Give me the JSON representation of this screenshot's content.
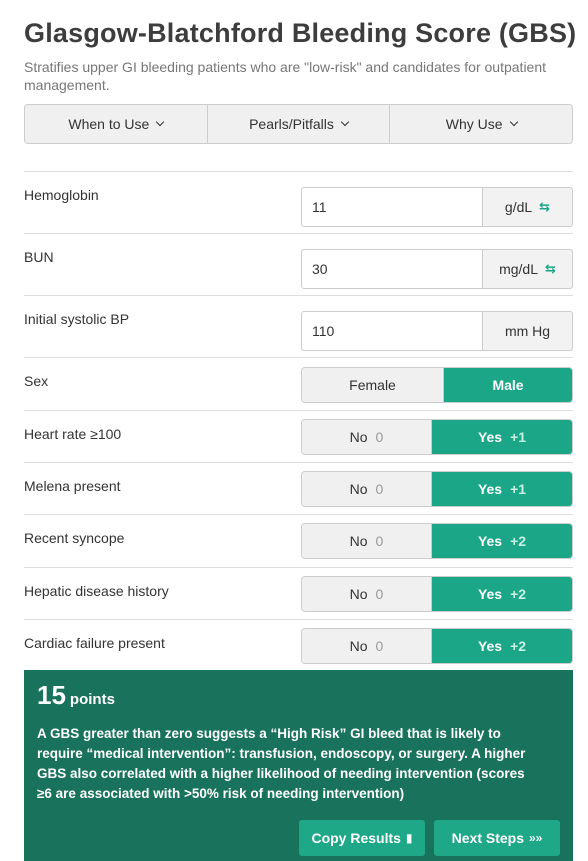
{
  "title": "Glasgow-Blatchford Bleeding Score (GBS)",
  "subtitle": "Stratifies upper GI bleeding patients who are \"low-risk\" and candidates for outpatient management.",
  "tabs": [
    {
      "label": "When to Use"
    },
    {
      "label": "Pearls/Pitfalls"
    },
    {
      "label": "Why Use"
    }
  ],
  "inputs": {
    "hemoglobin": {
      "label": "Hemoglobin",
      "value": "11",
      "unit": "g/dL"
    },
    "bun": {
      "label": "BUN",
      "value": "30",
      "unit": "mg/dL"
    },
    "sbp": {
      "label": "Initial systolic BP",
      "value": "110",
      "unit": "mm Hg"
    }
  },
  "sex": {
    "label": "Sex",
    "options": [
      "Female",
      "Male"
    ],
    "selected": "Male"
  },
  "toggles": {
    "heart_rate": {
      "label": "Heart rate ≥100",
      "no_label": "No",
      "no_pts": "0",
      "yes_label": "Yes",
      "yes_pts": "+1"
    },
    "melena": {
      "label": "Melena present",
      "no_label": "No",
      "no_pts": "0",
      "yes_label": "Yes",
      "yes_pts": "+1"
    },
    "syncope": {
      "label": "Recent syncope",
      "no_label": "No",
      "no_pts": "0",
      "yes_label": "Yes",
      "yes_pts": "+2"
    },
    "hepatic": {
      "label": "Hepatic disease history",
      "no_label": "No",
      "no_pts": "0",
      "yes_label": "Yes",
      "yes_pts": "+2"
    },
    "cardiac": {
      "label": "Cardiac failure present",
      "no_label": "No",
      "no_pts": "0",
      "yes_label": "Yes",
      "yes_pts": "+2"
    }
  },
  "result": {
    "score": "15",
    "unit": "points",
    "interpretation": "A GBS greater than zero suggests a “High Risk” GI bleed that is likely to require “medical intervention”: transfusion, endoscopy, or surgery. A higher GBS also correlated with a higher likelihood of needing intervention (scores ≥6 are associated with >50% risk of needing intervention)",
    "copy_label": "Copy Results",
    "next_label": "Next Steps"
  },
  "colors": {
    "accent": "#1aa687",
    "result_bg": "#19735c",
    "button": "#1fa888"
  },
  "icons": {
    "tab_chevron": "chevron-down-icon",
    "unit_swap": "swap-units-icon",
    "copy": "clipboard-icon",
    "next": "chevrons-right-icon"
  }
}
